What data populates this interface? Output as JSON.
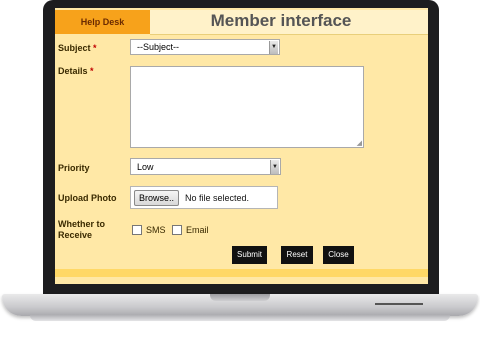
{
  "header": {
    "tab_label": "Help Desk",
    "title": "Member interface"
  },
  "form": {
    "subject_label": "Subject",
    "subject_value": "--Subject--",
    "details_label": "Details",
    "required_mark": "*",
    "priority_label": "Priority",
    "priority_value": "Low",
    "upload_label": "Upload Photo",
    "browse_label": "Browse..",
    "file_status": "No file selected.",
    "receive_label_line1": "Whether to",
    "receive_label_line2": "Receive",
    "option_sms": "SMS",
    "option_email": "Email"
  },
  "buttons": {
    "submit": "Submit",
    "reset": "Reset",
    "close": "Close"
  }
}
